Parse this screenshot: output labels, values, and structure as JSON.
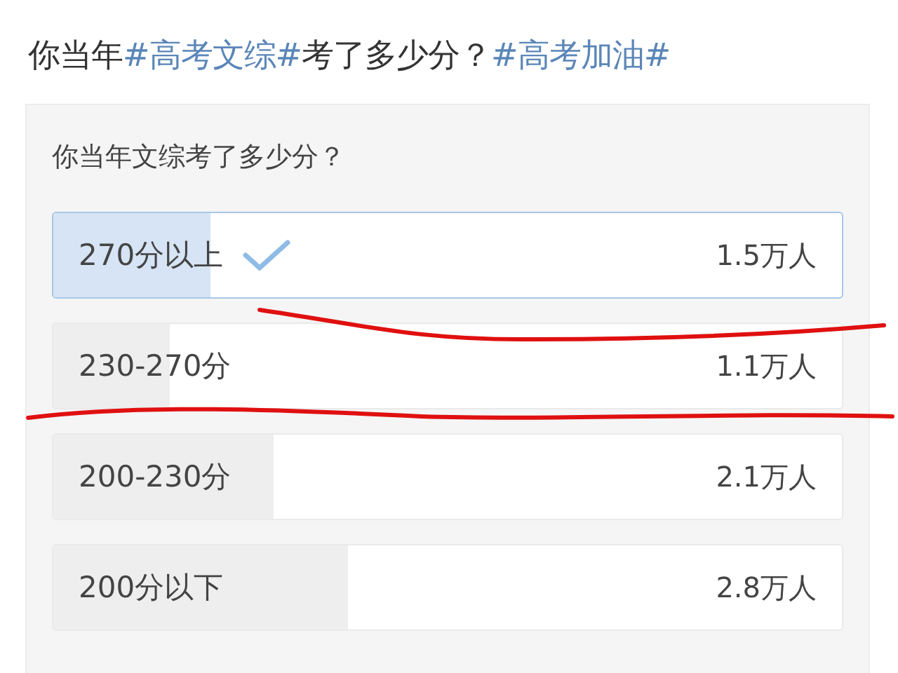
{
  "post": {
    "parts": [
      {
        "text": "你当年",
        "kind": "plain"
      },
      {
        "text": "#高考文综#",
        "kind": "topic"
      },
      {
        "text": "考了多少分？",
        "kind": "plain"
      },
      {
        "text": "#高考加油#",
        "kind": "topic"
      }
    ]
  },
  "poll": {
    "question": "你当年文综考了多少分？",
    "options": [
      {
        "label": "270分以上",
        "count": "1.5万人",
        "level": 0.2,
        "selected": true
      },
      {
        "label": "230-270分",
        "count": "1.1万人",
        "level": 0.147,
        "selected": false
      },
      {
        "label": "200-230分",
        "count": "2.1万人",
        "level": 0.28,
        "selected": false
      },
      {
        "label": "200分以下",
        "count": "2.8万人",
        "level": 0.373,
        "selected": false
      }
    ]
  }
}
